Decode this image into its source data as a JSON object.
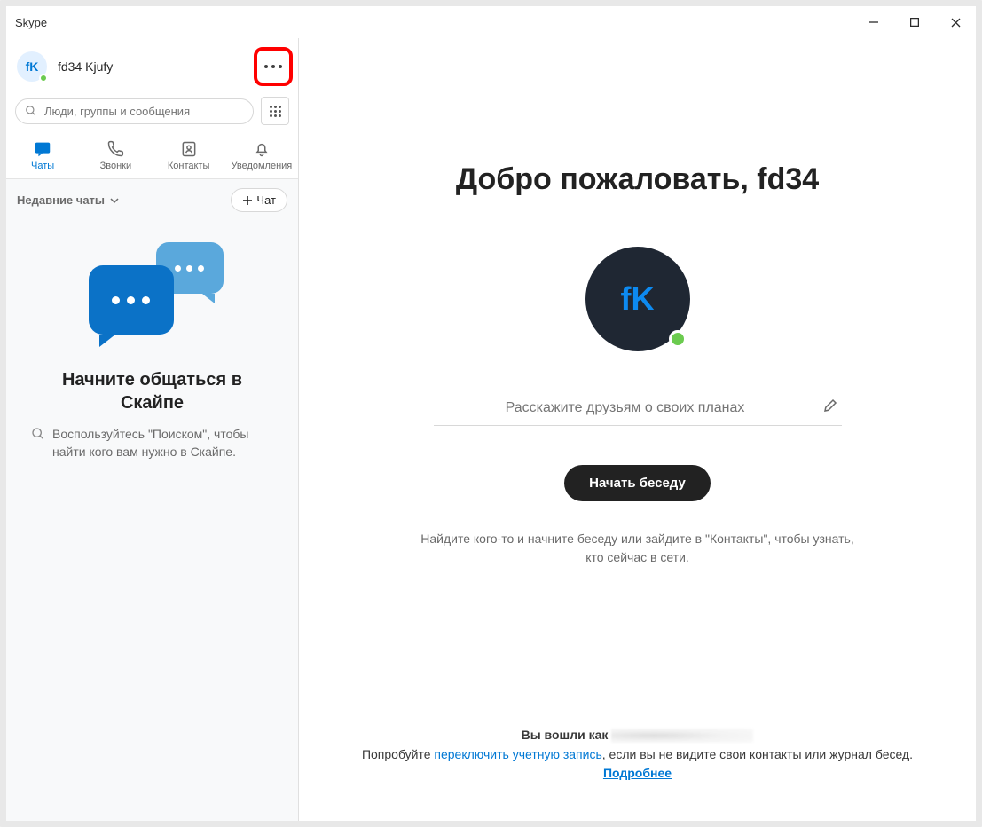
{
  "window": {
    "title": "Skype"
  },
  "profile": {
    "initials": "fK",
    "name": "fd34 Kjufy"
  },
  "search": {
    "placeholder": "Люди, группы и сообщения"
  },
  "tabs": [
    {
      "label": "Чаты"
    },
    {
      "label": "Звонки"
    },
    {
      "label": "Контакты"
    },
    {
      "label": "Уведомления"
    }
  ],
  "recent": {
    "label": "Недавние чаты",
    "new_chat": "Чат"
  },
  "empty": {
    "title": "Начните общаться в Скайпе",
    "subtitle": "Воспользуйтесь \"Поиском\", чтобы найти кого вам нужно в Скайпе."
  },
  "main": {
    "welcome": "Добро пожаловать, fd34",
    "avatar_initials": "fK",
    "status_placeholder": "Расскажите друзьям о своих планах",
    "start_button": "Начать беседу",
    "find_text": "Найдите кого-то и начните беседу или зайдите в \"Контакты\", чтобы узнать, кто сейчас в сети."
  },
  "footer": {
    "signed_as_prefix": "Вы вошли как",
    "try_prefix": "Попробуйте ",
    "switch_account": "переключить учетную запись",
    "try_suffix": ", если вы не видите свои контакты или журнал бесед.",
    "learn_more": "Подробнее"
  }
}
